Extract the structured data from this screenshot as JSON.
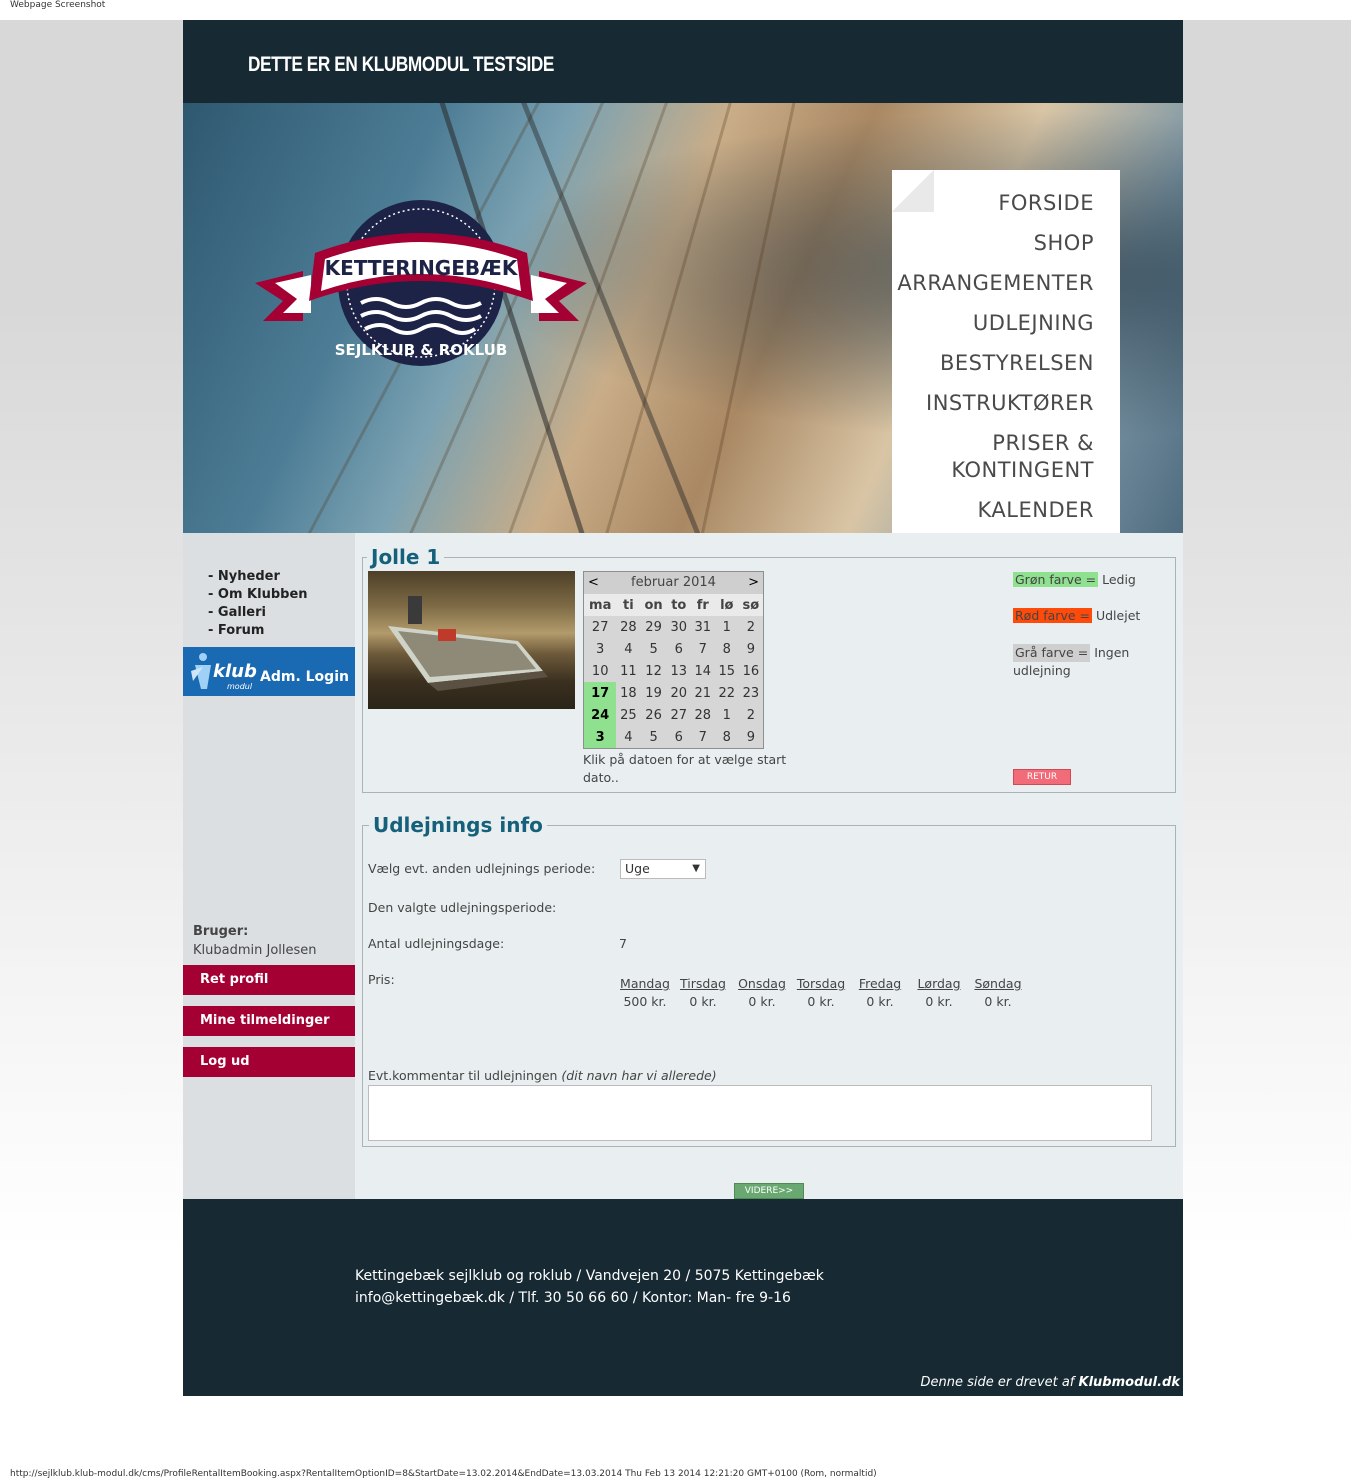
{
  "browser": {
    "caption": "Webpage Screenshot",
    "url_status": "http://sejlklub.klub-modul.dk/cms/ProfileRentalItemBooking.aspx?RentalItemOptionID=8&StartDate=13.02.2014&EndDate=13.03.2014 Thu Feb 13 2014 12:21:20 GMT+0100 (Rom, normaltid)"
  },
  "header": {
    "title": "DETTE ER EN KLUBMODUL TESTSIDE"
  },
  "logo": {
    "top_text": "KETTERINGEBÆK",
    "bottom_text": "SEJLKLUB & ROKLUB"
  },
  "nav": [
    "FORSIDE",
    "SHOP",
    "ARRANGEMENTER",
    "UDLEJNING",
    "BESTYRELSEN",
    "INSTRUKTØRER",
    "PRISER &",
    "KONTINGENT",
    "KALENDER"
  ],
  "sidebar": {
    "links": [
      "- Nyheder",
      "- Om Klubben",
      "- Galleri",
      "- Forum"
    ],
    "adm_logo": "klub",
    "adm_logo_sub": "modul",
    "adm_login": "Adm. Login",
    "user_label": "Bruger:",
    "user_name": "Klubadmin Jollesen",
    "buttons": [
      "Ret profil",
      "Mine tilmeldinger",
      "Log ud"
    ]
  },
  "item": {
    "title": "Jolle 1",
    "calendar": {
      "prev": "<",
      "next": ">",
      "month": "februar 2014",
      "weekdays": [
        "ma",
        "ti",
        "on",
        "to",
        "fr",
        "lø",
        "sø"
      ],
      "rows": [
        [
          "27",
          "28",
          "29",
          "30",
          "31",
          "1",
          "2"
        ],
        [
          "3",
          "4",
          "5",
          "6",
          "7",
          "8",
          "9"
        ],
        [
          "10",
          "11",
          "12",
          "13",
          "14",
          "15",
          "16"
        ],
        [
          "17",
          "18",
          "19",
          "20",
          "21",
          "22",
          "23"
        ],
        [
          "24",
          "25",
          "26",
          "27",
          "28",
          "1",
          "2"
        ],
        [
          "3",
          "4",
          "5",
          "6",
          "7",
          "8",
          "9"
        ]
      ],
      "hint": "Klik på datoen for at vælge start dato.."
    },
    "legend": {
      "green": "Grøn farve =",
      "green_text": "Ledig",
      "red": "Rød farve  =",
      "red_text": "Udlejet",
      "grey": "Grå farve  =",
      "grey_text": "Ingen udlejning",
      "colors": {
        "green": "#8fe08f",
        "red": "#ff4a0a",
        "grey": "#cfcfcf"
      }
    },
    "back_button": "RETUR"
  },
  "rental_info": {
    "title": "Udlejnings info",
    "period_label": "Vælg evt. anden udlejnings periode:",
    "period_value": "Uge",
    "chosen_label": "Den valgte udlejningsperiode:",
    "days_label": "Antal udlejningsdage:",
    "days_value": "7",
    "price_label": "Pris:",
    "prices": [
      {
        "day": "Mandag",
        "price": "500 kr."
      },
      {
        "day": "Tirsdag",
        "price": "0 kr."
      },
      {
        "day": "Onsdag",
        "price": "0 kr."
      },
      {
        "day": "Torsdag",
        "price": "0 kr."
      },
      {
        "day": "Fredag",
        "price": "0 kr."
      },
      {
        "day": "Lørdag",
        "price": "0 kr."
      },
      {
        "day": "Søndag",
        "price": "0 kr."
      }
    ],
    "comment_label": "Evt.kommentar til udlejningen",
    "comment_hint": "(dit navn har vi allerede)"
  },
  "continue_button": "VIDERE>>",
  "footer": {
    "line1": "Kettingebæk sejlklub og roklub / Vandvejen 20 / 5075 Kettingebæk",
    "line2": "info@kettingebæk.dk / Tlf. 30 50 66 60 / Kontor: Man- fre 9-16",
    "powered_prefix": "Denne side er drevet af",
    "powered_brand": "Klubmodul.dk"
  }
}
